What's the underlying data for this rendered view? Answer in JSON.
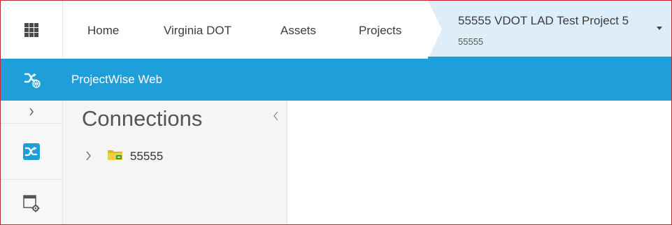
{
  "topnav": {
    "items": [
      {
        "label": "Home"
      },
      {
        "label": "Virginia DOT"
      },
      {
        "label": "Assets"
      },
      {
        "label": "Projects"
      }
    ],
    "active": {
      "title": "55555 VDOT LAD Test Project 5",
      "subtitle": "55555"
    }
  },
  "appbar": {
    "title": "ProjectWise Web"
  },
  "panel": {
    "title": "Connections",
    "tree": [
      {
        "label": "55555"
      }
    ]
  },
  "colors": {
    "accent": "#1f9fd9",
    "active_crumb_bg": "#deeef9",
    "frame_border": "#c0282d"
  },
  "icons": {
    "apps": "apps-grid-icon",
    "projectwise": "projectwise-icon",
    "window_settings": "window-settings-icon",
    "folder": "folder-icon"
  }
}
